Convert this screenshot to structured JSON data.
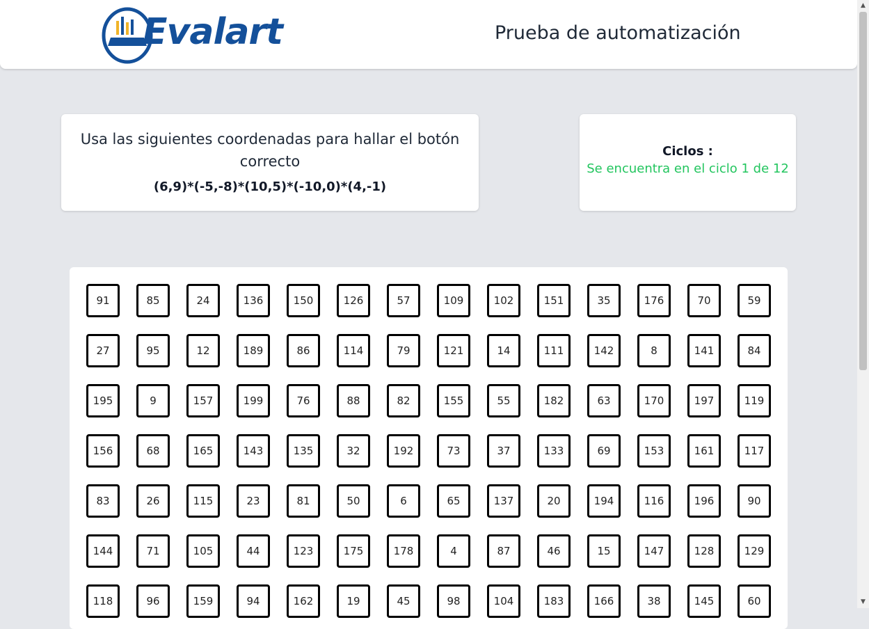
{
  "header": {
    "logo_text": "Evalart",
    "title": "Prueba de automatización"
  },
  "instructions": {
    "text": "Usa las siguientes coordenadas para hallar el botón correcto",
    "coordinates": "(6,9)*(-5,-8)*(10,5)*(-10,0)*(4,-1)"
  },
  "cycles": {
    "label": "Ciclos :",
    "status": "Se encuentra en el ciclo 1 de 12",
    "status_color": "#22c55e"
  },
  "grid": {
    "rows": [
      [
        "91",
        "85",
        "24",
        "136",
        "150",
        "126",
        "57",
        "109",
        "102",
        "151",
        "35",
        "176",
        "70",
        "59"
      ],
      [
        "27",
        "95",
        "12",
        "189",
        "86",
        "114",
        "79",
        "121",
        "14",
        "111",
        "142",
        "8",
        "141",
        "84"
      ],
      [
        "195",
        "9",
        "157",
        "199",
        "76",
        "88",
        "82",
        "155",
        "55",
        "182",
        "63",
        "170",
        "197",
        "119"
      ],
      [
        "156",
        "68",
        "165",
        "143",
        "135",
        "32",
        "192",
        "73",
        "37",
        "133",
        "69",
        "153",
        "161",
        "117"
      ],
      [
        "83",
        "26",
        "115",
        "23",
        "81",
        "50",
        "6",
        "65",
        "137",
        "20",
        "194",
        "116",
        "196",
        "90"
      ],
      [
        "144",
        "71",
        "105",
        "44",
        "123",
        "175",
        "178",
        "4",
        "87",
        "46",
        "15",
        "147",
        "128",
        "129"
      ],
      [
        "118",
        "96",
        "159",
        "94",
        "162",
        "19",
        "45",
        "98",
        "104",
        "183",
        "166",
        "38",
        "145",
        "60"
      ]
    ]
  },
  "colors": {
    "brand": "#14509a",
    "logo_accent": "#f0b429",
    "background": "#e5e7eb"
  }
}
